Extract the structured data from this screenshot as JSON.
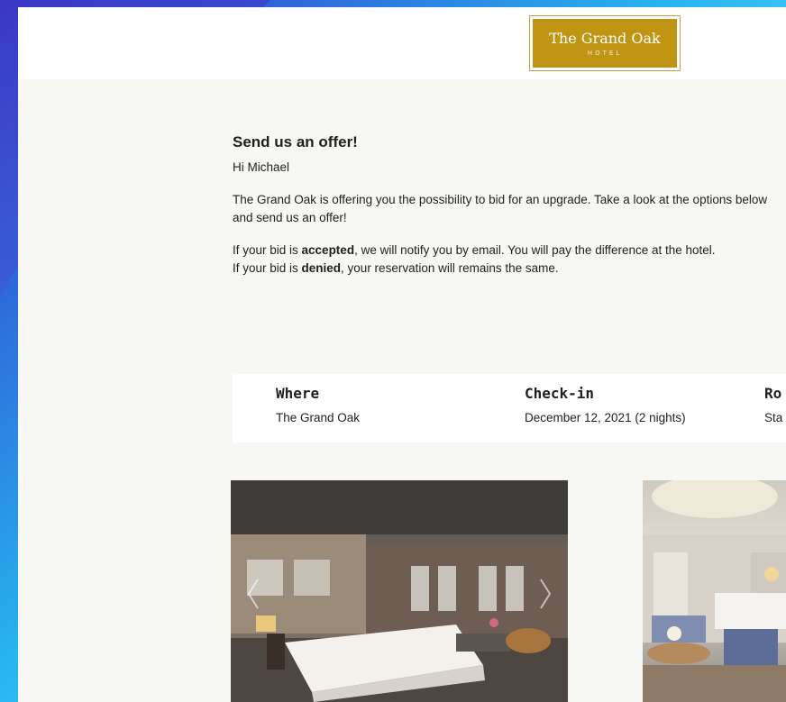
{
  "hotel": {
    "logo_name": "The Grand Oak",
    "logo_sub": "HOTEL"
  },
  "offer": {
    "title": "Send us an offer!",
    "greeting": "Hi Michael",
    "intro": "The Grand Oak is offering you the possibility to bid for an upgrade. Take a look at the options below and send us an offer!",
    "accepted_prefix": "If your bid is ",
    "accepted_word": "accepted",
    "accepted_suffix": ",  we will notify you by email. You will pay the difference at the hotel.",
    "denied_prefix": "If your bid is ",
    "denied_word": "denied",
    "denied_suffix": ", your reservation will remains the same."
  },
  "summary": {
    "where_label": "Where",
    "where_value": "The Grand Oak",
    "checkin_label": "Check-in",
    "checkin_value": "December 12, 2021  (2  nights)",
    "room_label": "Ro",
    "room_value": "Sta"
  },
  "colors": {
    "logo_gold": "#c09514",
    "page_bg": "#f7f7f4"
  },
  "icons": {
    "prev": "chevron-left-icon",
    "next": "chevron-right-icon"
  }
}
